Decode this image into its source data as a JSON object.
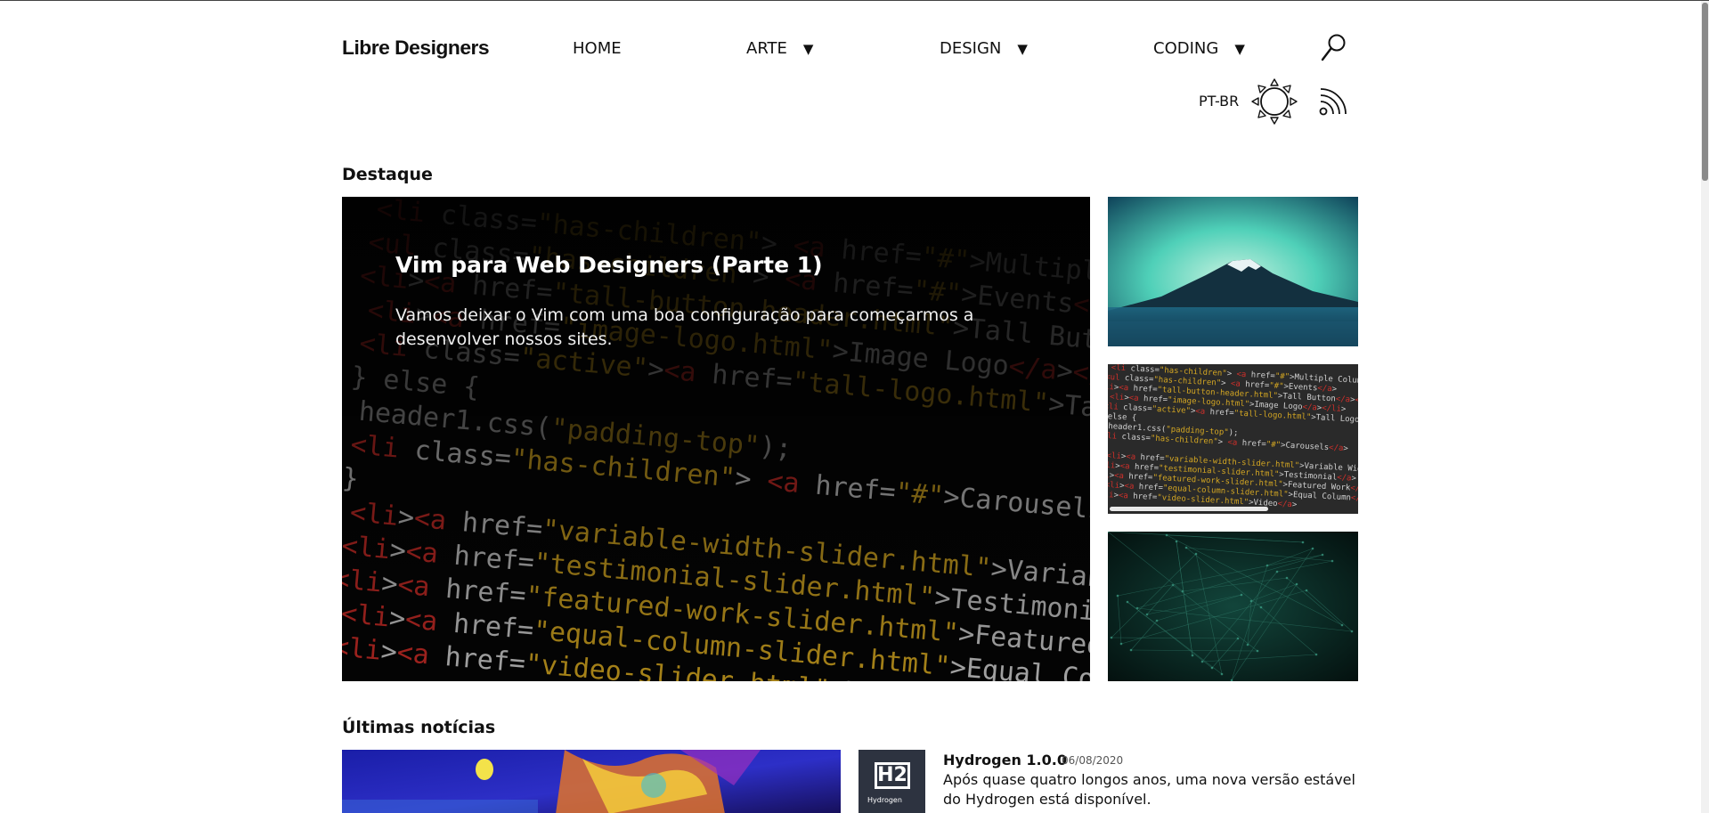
{
  "header": {
    "logo": "Libre Designers",
    "nav": [
      {
        "label": "HOME",
        "has_dropdown": false
      },
      {
        "label": "ARTE",
        "has_dropdown": true
      },
      {
        "label": "DESIGN",
        "has_dropdown": true
      },
      {
        "label": "CODING",
        "has_dropdown": true
      }
    ],
    "caret": "▼",
    "language": "PT-BR",
    "icons": {
      "search": "search-icon",
      "theme": "sun-icon",
      "feed": "rss-icon"
    }
  },
  "featured": {
    "heading": "Destaque",
    "main": {
      "title": "Vim para Web Designers (Parte 1)",
      "description": "Vamos deixar o Vim com uma boa configuração para começarmos a desenvolver nossos sites."
    },
    "code_lines": [
      "<li class=\"has-children\"> <a href=\"#\">Multiple Column Menu</a>",
      "<ul class=\"has-children\"> <a href=\"#\">Events</a>",
      "<li><a href=\"tall-button-header.html\">Tall Button</a></li>",
      "<li><a href=\"image-logo.html\">Image Logo</a></li>",
      "<li class=\"active\"><a href=\"tall-logo.html\">Tall Logo</a></li>",
      "} else {",
      "header1.css(\"padding-top\");",
      "<li class=\"has-children\"> <a href=\"#\">Carousels</a>",
      "}",
      "<li><a href=\"variable-width-slider.html\">Variable Width</a>",
      "<li><a href=\"testimonial-slider.html\">Testimonial</a>",
      "<li><a href=\"featured-work-slider.html\">Featured Work</a>",
      "<li><a href=\"equal-column-slider.html\">Equal Column</a>",
      "<li><a href=\"video-slider.html\">Video</a>"
    ]
  },
  "latest": {
    "heading": "Últimas notícias",
    "items": [
      {
        "title": "Hydrogen 1.0.0",
        "date": "06/08/2020",
        "description": "Após quase quatro longos anos, uma nova versão estável do Hydrogen está disponível.",
        "thumb_text": "H2",
        "thumb_caption": "Hydrogen"
      }
    ]
  },
  "colors": {
    "code_tag": "#e0302a",
    "code_attr": "#46b93a",
    "code_string": "#e6b422",
    "code_text": "#e0e0e0"
  }
}
